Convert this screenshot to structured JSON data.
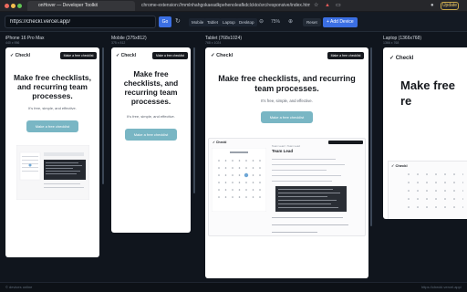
{
  "browser": {
    "tab_title": "onHover — Developer Toolkit",
    "url": "chrome-extension://mmlnhahgokaeadkpehenoleafkdclckto/src/responsive/index.html",
    "update_label": "Update"
  },
  "toolbar": {
    "address_value": "https://checkl.vercel.app/",
    "go_label": "Go",
    "presets": [
      "Mobile",
      "Tablet",
      "Laptop",
      "Desktop"
    ],
    "zoom_level": "75%",
    "reset_label": "Reset",
    "add_device_label": "+ Add Device"
  },
  "site": {
    "logo": "Checkl",
    "nav_cta": "Make a free checklist",
    "headline": "Make free checklists, and recurring team processes.",
    "subtitle": "It's free, simple, and effective.",
    "cta": "Make a free checklist",
    "preview_title": "Team Lead",
    "preview_breadcrumb": "Team Lead > Team Lead"
  },
  "devices": [
    {
      "name": "iPhone 16 Pro Max",
      "dims": "440 x 956"
    },
    {
      "name": "Mobile (375x812)",
      "dims": "375 x 812"
    },
    {
      "name": "Tablet (768x1024)",
      "dims": "768 x 1024"
    },
    {
      "name": "Laptop (1366x768)",
      "dims": "1366 x 768"
    }
  ],
  "statusbar": {
    "left": "© devices online",
    "right": "https://checkl.vercel.app/"
  },
  "colors": {
    "accent": "#3b6fe3",
    "cta": "#79b6c4",
    "background": "#10151d"
  }
}
